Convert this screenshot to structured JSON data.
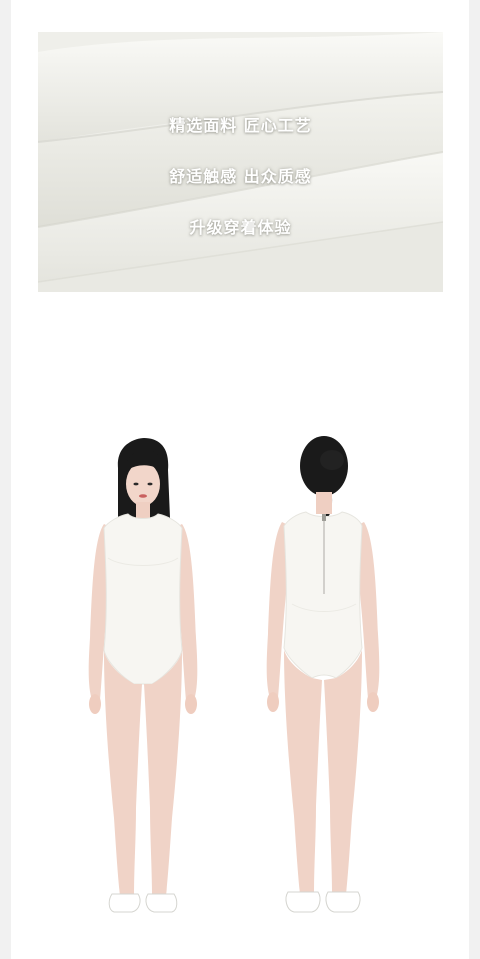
{
  "fabric_banner": {
    "lines": [
      "精选面料 匠心工艺",
      "舒适触感 出众质感",
      "升级穿着体验"
    ]
  },
  "models": [
    {
      "view": "front"
    },
    {
      "view": "back"
    }
  ],
  "colors": {
    "side_background": "#f1f1f1",
    "page_background": "#ffffff",
    "fabric": "#ecece6",
    "swimsuit": "#f7f6f2",
    "skin": "#f0d3c7",
    "hair": "#1a1a1a"
  }
}
